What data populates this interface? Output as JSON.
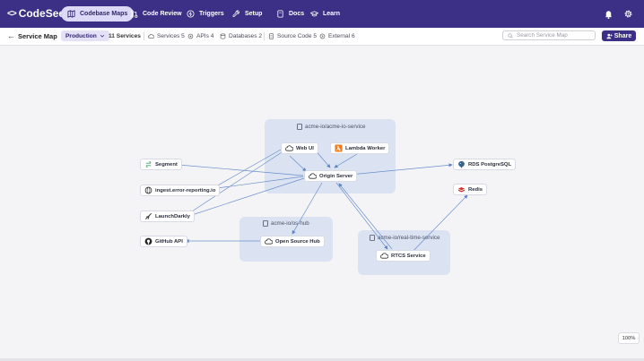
{
  "topbar": {
    "logo": "CodeSee",
    "nav": [
      {
        "label": "Codebase Maps",
        "icon": "map-icon",
        "active": true
      },
      {
        "label": "Code Review",
        "icon": "pull-request-icon",
        "active": false
      },
      {
        "label": "Triggers",
        "icon": "trigger-icon",
        "active": false
      },
      {
        "label": "Setup",
        "icon": "wrench-icon",
        "active": false
      },
      {
        "label": "Docs",
        "icon": "docs-icon",
        "active": false
      },
      {
        "label": "Learn",
        "icon": "graduation-cap-icon",
        "active": false
      }
    ],
    "icons": [
      "bell-icon",
      "gear-icon"
    ]
  },
  "toolbar": {
    "title": "Service Map",
    "environment": "Production",
    "service_count": "11 Services",
    "filters": [
      {
        "label": "Services 5",
        "icon": "cloud-icon"
      },
      {
        "label": "APIs 4",
        "icon": "api-icon"
      },
      {
        "label": "Databases 2",
        "icon": "database-icon"
      },
      {
        "label": "Source Code 5",
        "icon": "file-icon"
      },
      {
        "label": "External 6",
        "icon": "external-icon"
      }
    ],
    "search_placeholder": "Search Service Map",
    "share_label": "Share"
  },
  "map": {
    "groups": [
      {
        "label": "acme-io/acme-io-service"
      },
      {
        "label": "acme-io/os-hub"
      },
      {
        "label": "acme-io/real-time-service"
      }
    ],
    "nodes": [
      {
        "id": "web-ui",
        "label": "Web UI",
        "icon": "cloud-icon"
      },
      {
        "id": "lambda-worker",
        "label": "Lambda Worker",
        "icon": "aws-lambda-icon"
      },
      {
        "id": "origin-server",
        "label": "Origin Server",
        "icon": "cloud-icon"
      },
      {
        "id": "segment",
        "label": "Segment",
        "icon": "segment-icon"
      },
      {
        "id": "ingest",
        "label": "ingest.error-reporting.io",
        "icon": "globe-icon"
      },
      {
        "id": "launchdarkly",
        "label": "LaunchDarkly",
        "icon": "launchdarkly-icon"
      },
      {
        "id": "github-api",
        "label": "GitHub API",
        "icon": "github-icon"
      },
      {
        "id": "open-source-hub",
        "label": "Open Source Hub",
        "icon": "cloud-icon"
      },
      {
        "id": "rtcs-service",
        "label": "RTCS Service",
        "icon": "cloud-icon"
      },
      {
        "id": "rds",
        "label": "RDS PostgreSQL",
        "icon": "postgresql-icon"
      },
      {
        "id": "redis",
        "label": "Redis",
        "icon": "redis-icon"
      }
    ],
    "zoom": "100%"
  },
  "colors": {
    "brand": "#3b2f86",
    "edge": "#5b82c4",
    "group_bg": "#dbe2f1"
  }
}
